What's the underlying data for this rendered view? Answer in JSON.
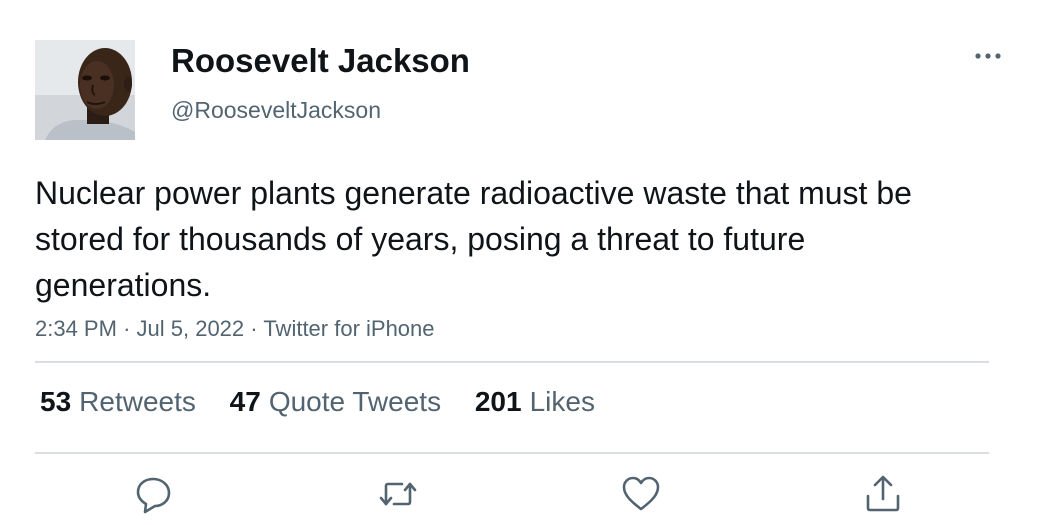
{
  "user": {
    "display_name": "Roosevelt Jackson",
    "handle": "@RooseveltJackson"
  },
  "tweet": {
    "text": "Nuclear power plants generate radioactive waste that must be stored for thousands of years, posing a threat to future generations.",
    "time": "2:34 PM",
    "separator": "·",
    "date": "Jul 5, 2022",
    "source": "Twitter for iPhone"
  },
  "stats": {
    "retweets_count": "53",
    "retweets_label": "Retweets",
    "quotes_count": "47",
    "quotes_label": "Quote Tweets",
    "likes_count": "201",
    "likes_label": "Likes"
  },
  "actions": [
    "reply-icon",
    "retweet-icon",
    "like-icon",
    "share-icon"
  ],
  "colors": {
    "primary_text": "#0f1419",
    "secondary_text": "#536471",
    "divider": "#dadee2"
  }
}
